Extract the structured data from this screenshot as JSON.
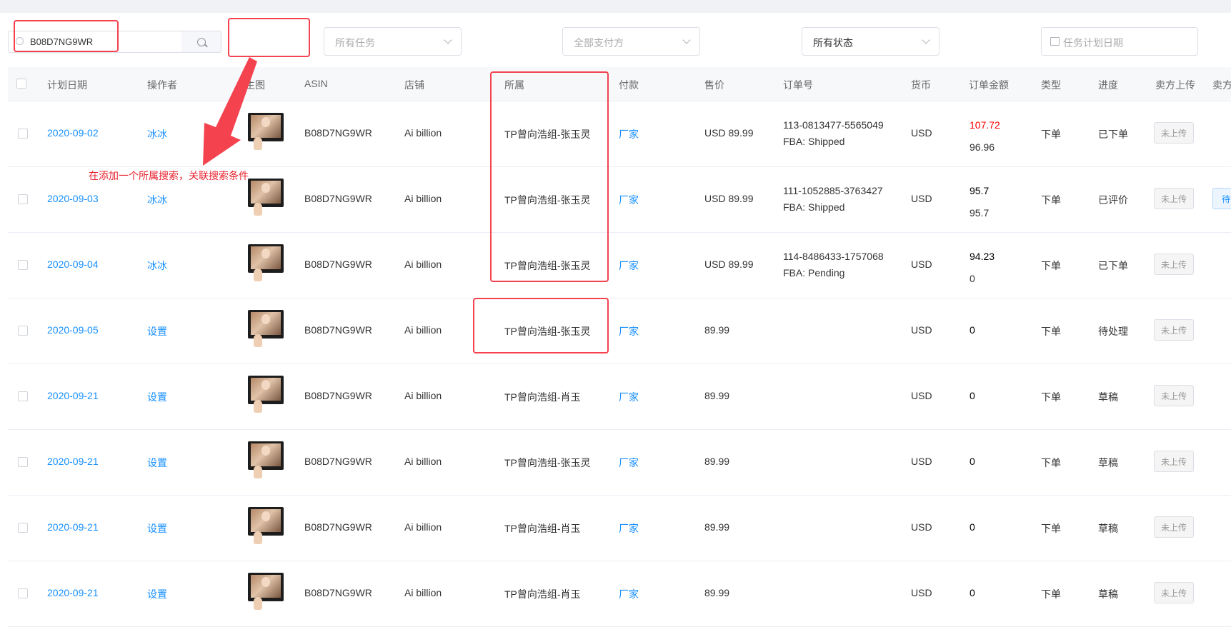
{
  "filters": {
    "search_value": "B08D7NG9WR",
    "task_placeholder": "所有任务",
    "payer_placeholder": "全部支付方",
    "status_value": "所有状态",
    "date_placeholder": "任务计划日期"
  },
  "columns": {
    "date": "计划日期",
    "operator": "操作者",
    "image": "主图",
    "asin": "ASIN",
    "store": "店铺",
    "owner": "所属",
    "payment": "付款",
    "price": "售价",
    "order_no": "订单号",
    "currency": "货币",
    "amount": "订单金额",
    "type": "类型",
    "progress": "进度",
    "seller_upload": "卖方上传",
    "seller_extra": "卖方"
  },
  "rows": [
    {
      "date": "2020-09-02",
      "operator": "冰冰",
      "asin": "B08D7NG9WR",
      "store": "Ai billion",
      "owner": "TP曾向浩组-张玉灵",
      "payment": "厂家",
      "price": "USD 89.99",
      "order_no": "113-0813477-5565049",
      "order_status": "FBA: Shipped",
      "currency": "USD",
      "amount": "107.72",
      "amount2": "96.96",
      "type": "下单",
      "progress": "已下单",
      "upload": "未上传",
      "tag": ""
    },
    {
      "date": "2020-09-03",
      "operator": "冰冰",
      "asin": "B08D7NG9WR",
      "store": "Ai billion",
      "owner": "TP曾向浩组-张玉灵",
      "payment": "厂家",
      "price": "USD 89.99",
      "order_no": "111-1052885-3763427",
      "order_status": "FBA: Shipped",
      "currency": "USD",
      "amount": "95.7",
      "amount2": "95.7",
      "type": "下单",
      "progress": "已评价",
      "upload": "未上传",
      "tag": "待审"
    },
    {
      "date": "2020-09-04",
      "operator": "冰冰",
      "asin": "B08D7NG9WR",
      "store": "Ai billion",
      "owner": "TP曾向浩组-张玉灵",
      "payment": "厂家",
      "price": "USD 89.99",
      "order_no": "114-8486433-1757068",
      "order_status": "FBA: Pending",
      "currency": "USD",
      "amount": "94.23",
      "amount2": "0",
      "type": "下单",
      "progress": "已下单",
      "upload": "未上传",
      "tag": ""
    },
    {
      "date": "2020-09-05",
      "operator": "设置",
      "asin": "B08D7NG9WR",
      "store": "Ai billion",
      "owner": "TP曾向浩组-张玉灵",
      "payment": "厂家",
      "price": "89.99",
      "order_no": "",
      "order_status": "",
      "currency": "USD",
      "amount": "0",
      "amount2": "",
      "type": "下单",
      "progress": "待处理",
      "upload": "未上传",
      "tag": ""
    },
    {
      "date": "2020-09-21",
      "operator": "设置",
      "asin": "B08D7NG9WR",
      "store": "Ai billion",
      "owner": "TP曾向浩组-肖玉",
      "payment": "厂家",
      "price": "89.99",
      "order_no": "",
      "order_status": "",
      "currency": "USD",
      "amount": "0",
      "amount2": "",
      "type": "下单",
      "progress": "草稿",
      "upload": "未上传",
      "tag": ""
    },
    {
      "date": "2020-09-21",
      "operator": "设置",
      "asin": "B08D7NG9WR",
      "store": "Ai billion",
      "owner": "TP曾向浩组-张玉灵",
      "payment": "厂家",
      "price": "89.99",
      "order_no": "",
      "order_status": "",
      "currency": "USD",
      "amount": "0",
      "amount2": "",
      "type": "下单",
      "progress": "草稿",
      "upload": "未上传",
      "tag": ""
    },
    {
      "date": "2020-09-21",
      "operator": "设置",
      "asin": "B08D7NG9WR",
      "store": "Ai billion",
      "owner": "TP曾向浩组-肖玉",
      "payment": "厂家",
      "price": "89.99",
      "order_no": "",
      "order_status": "",
      "currency": "USD",
      "amount": "0",
      "amount2": "",
      "type": "下单",
      "progress": "草稿",
      "upload": "未上传",
      "tag": ""
    },
    {
      "date": "2020-09-21",
      "operator": "设置",
      "asin": "B08D7NG9WR",
      "store": "Ai billion",
      "owner": "TP曾向浩组-肖玉",
      "payment": "厂家",
      "price": "89.99",
      "order_no": "",
      "order_status": "",
      "currency": "USD",
      "amount": "0",
      "amount2": "",
      "type": "下单",
      "progress": "草稿",
      "upload": "未上传",
      "tag": ""
    }
  ],
  "annotation": {
    "note": "在添加一个所属搜索，关联搜索条件"
  },
  "colors": {
    "link": "#1890ff",
    "annotation": "#f5424f",
    "highlight_amount": "#ff0000"
  }
}
